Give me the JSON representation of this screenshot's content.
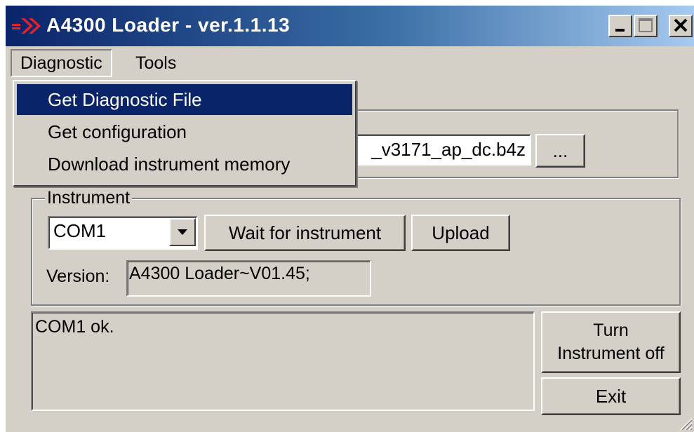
{
  "window": {
    "title": "A4300 Loader - ver.1.1.13",
    "icon": "double-chevron-logo-icon"
  },
  "titlebar_buttons": {
    "minimize_icon": "minimize-icon",
    "maximize_icon": "maximize-icon",
    "close_icon": "close-icon"
  },
  "menubar": {
    "items": [
      {
        "label": "Diagnostic",
        "open": true
      },
      {
        "label": "Tools",
        "open": false
      }
    ]
  },
  "dropdown": {
    "items": [
      {
        "label": "Get Diagnostic File",
        "highlighted": true
      },
      {
        "label": "Get configuration",
        "highlighted": false
      },
      {
        "label": "Download instrument memory",
        "highlighted": false
      }
    ]
  },
  "file": {
    "path_visible": "_v3171_ap_dc.b4z",
    "browse_label": "..."
  },
  "instrument": {
    "group_label": "Instrument",
    "port_selected": "COM1",
    "wait_button": "Wait for instrument",
    "upload_button": "Upload",
    "version_label": "Version:",
    "version_value": "A4300 Loader~V01.45;"
  },
  "log": {
    "text": "COM1 ok."
  },
  "actions": {
    "turn_off_line1": "Turn",
    "turn_off_line2": "Instrument off",
    "exit_label": "Exit"
  },
  "colors": {
    "titlebar_start": "#0a246a",
    "titlebar_end": "#a6caf0",
    "face": "#d4d0c8",
    "highlight": "#0a246a",
    "logo": "#e8202a"
  }
}
